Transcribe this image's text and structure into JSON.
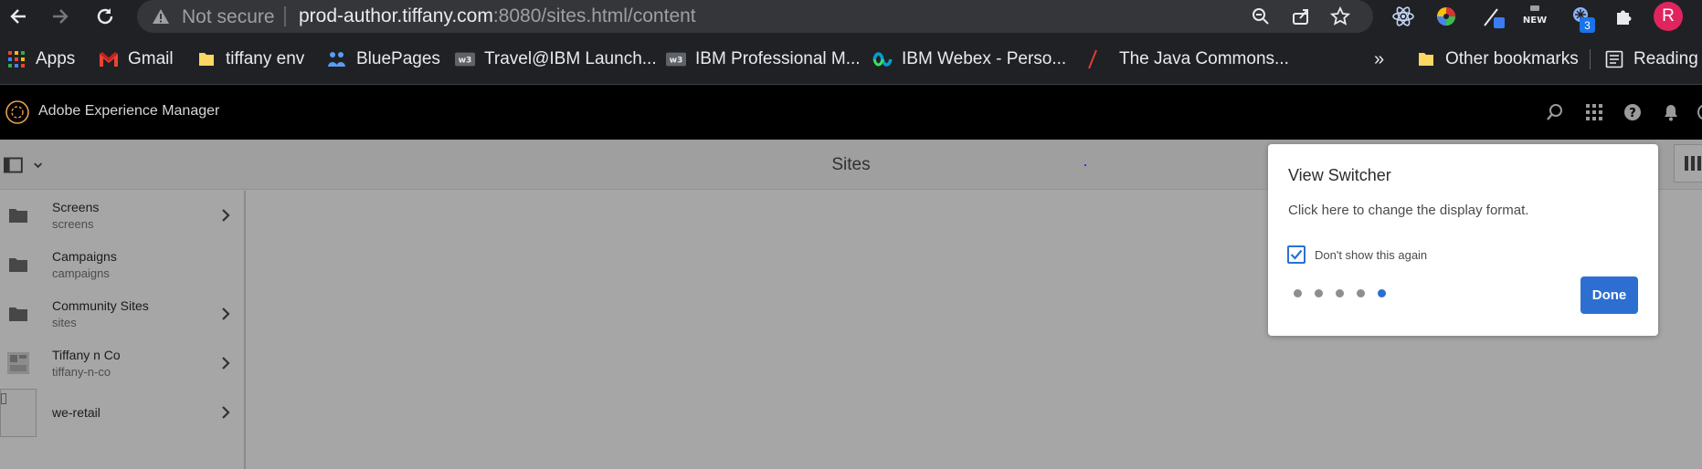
{
  "browser": {
    "omnibox": {
      "security_label": "Not secure",
      "url_host": "prod-author.tiffany.com",
      "url_rest": ":8080/sites.html/content"
    },
    "extensions": {
      "new_badge": "NEW",
      "count_badge": "3"
    },
    "profile_initial": "R"
  },
  "bookmarks": {
    "items": [
      {
        "label": "Apps",
        "icon": "apps-grid-icon"
      },
      {
        "label": "Gmail",
        "icon": "gmail-icon"
      },
      {
        "label": "tiffany env",
        "icon": "folder-icon"
      },
      {
        "label": "BluePages",
        "icon": "bluepages-icon"
      },
      {
        "label": "Travel@IBM Launch...",
        "icon": "w3-icon"
      },
      {
        "label": "IBM Professional M...",
        "icon": "w3-icon"
      },
      {
        "label": "IBM Webex - Perso...",
        "icon": "webex-icon"
      },
      {
        "label": "The Java Commons...",
        "icon": "slash-icon"
      }
    ],
    "overflow": "»",
    "other_bookmarks": "Other bookmarks",
    "reading_list": "Reading"
  },
  "aem": {
    "product_title": "Adobe Experience Manager"
  },
  "actionbar": {
    "title": "Sites"
  },
  "column": {
    "items": [
      {
        "title": "Screens",
        "subtitle": "screens",
        "thumb": "folder-icon",
        "has_children": true
      },
      {
        "title": "Campaigns",
        "subtitle": "campaigns",
        "thumb": "folder-icon",
        "has_children": false
      },
      {
        "title": "Community Sites",
        "subtitle": "sites",
        "thumb": "folder-icon",
        "has_children": true
      },
      {
        "title": "Tiffany n Co",
        "subtitle": "tiffany-n-co",
        "thumb": "site-thumbnail-icon",
        "has_children": true
      },
      {
        "title": "we-retail",
        "subtitle": "",
        "thumb": "page-thumbnail",
        "has_children": true
      }
    ]
  },
  "coachmark": {
    "title": "View Switcher",
    "text": "Click here to change the display format.",
    "checkbox_label": "Don't show this again",
    "checkbox_checked": true,
    "steps_total": 5,
    "step_current": 5,
    "done_label": "Done"
  },
  "colors": {
    "accent": "#2c6fd1",
    "aem_header": "#000000",
    "chrome_bg": "#202124",
    "profile": "#e0245e"
  }
}
